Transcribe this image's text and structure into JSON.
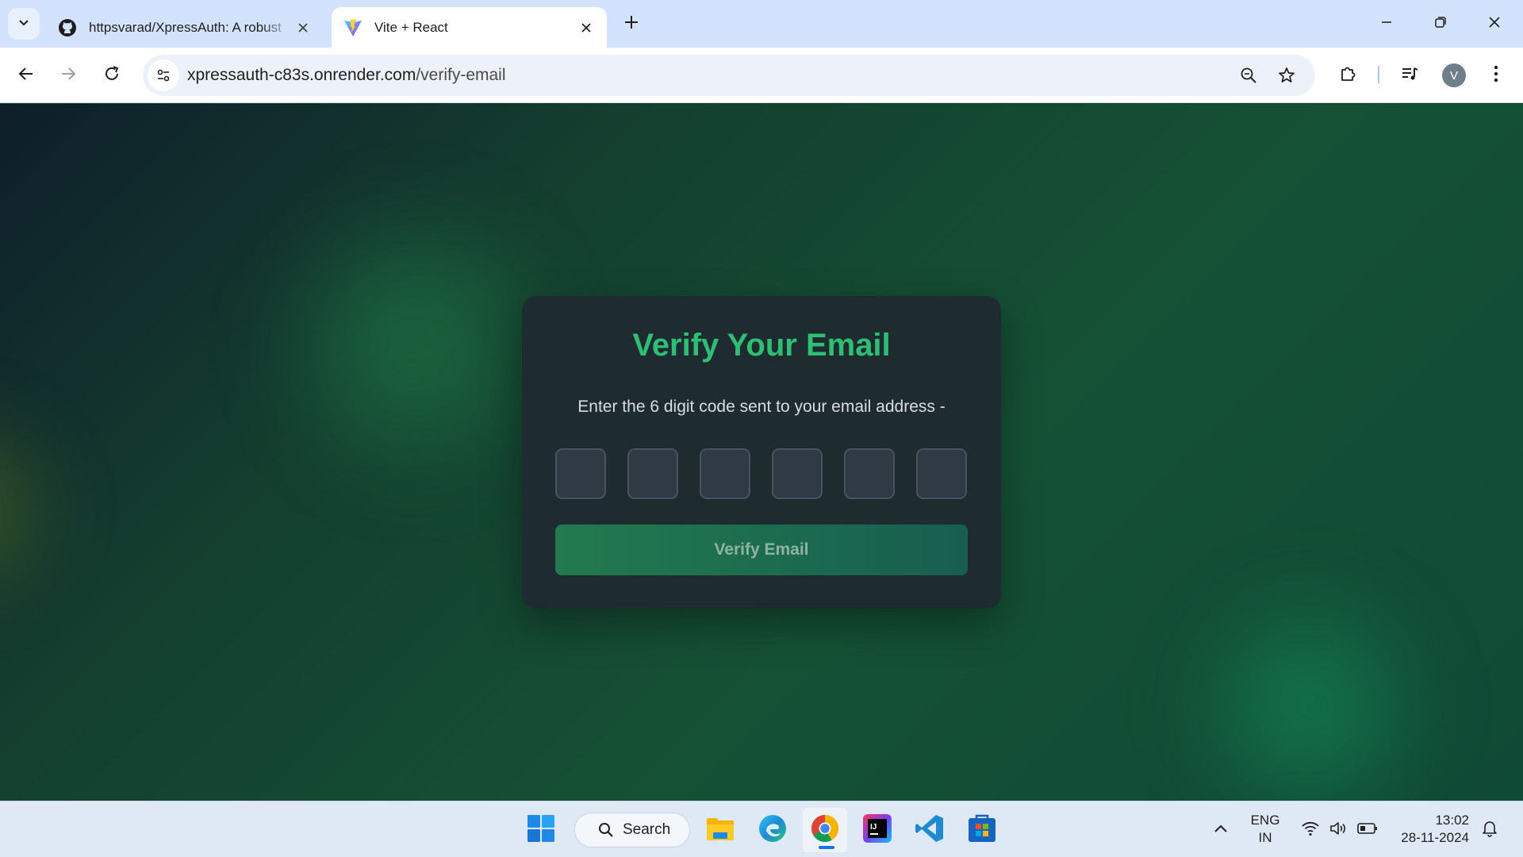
{
  "browser": {
    "tabs": [
      {
        "title": "httpsvarad/XpressAuth: A robust",
        "icon": "github-icon",
        "active": false
      },
      {
        "title": "Vite + React",
        "icon": "vite-icon",
        "active": true
      }
    ],
    "address": {
      "domain": "xpressauth-c83s.onrender.com",
      "path": "/verify-email"
    },
    "profile_initial": "V"
  },
  "verify_card": {
    "title": "Verify Your Email",
    "description": "Enter the 6 digit code sent to your email address -",
    "code_digits": [
      "",
      "",
      "",
      "",
      "",
      ""
    ],
    "button_label": "Verify Email"
  },
  "taskbar": {
    "search_label": "Search",
    "apps": [
      "windows-start-icon",
      "file-explorer-icon",
      "edge-icon",
      "chrome-icon",
      "intellij-icon",
      "vscode-icon",
      "microsoft-store-icon"
    ],
    "language": "ENG",
    "region": "IN",
    "time": "13:02",
    "date": "28-11-2024"
  },
  "colors": {
    "accent_green": "#2fbf74",
    "card_bg": "#1f2930",
    "button_bg": "#237a4f"
  }
}
